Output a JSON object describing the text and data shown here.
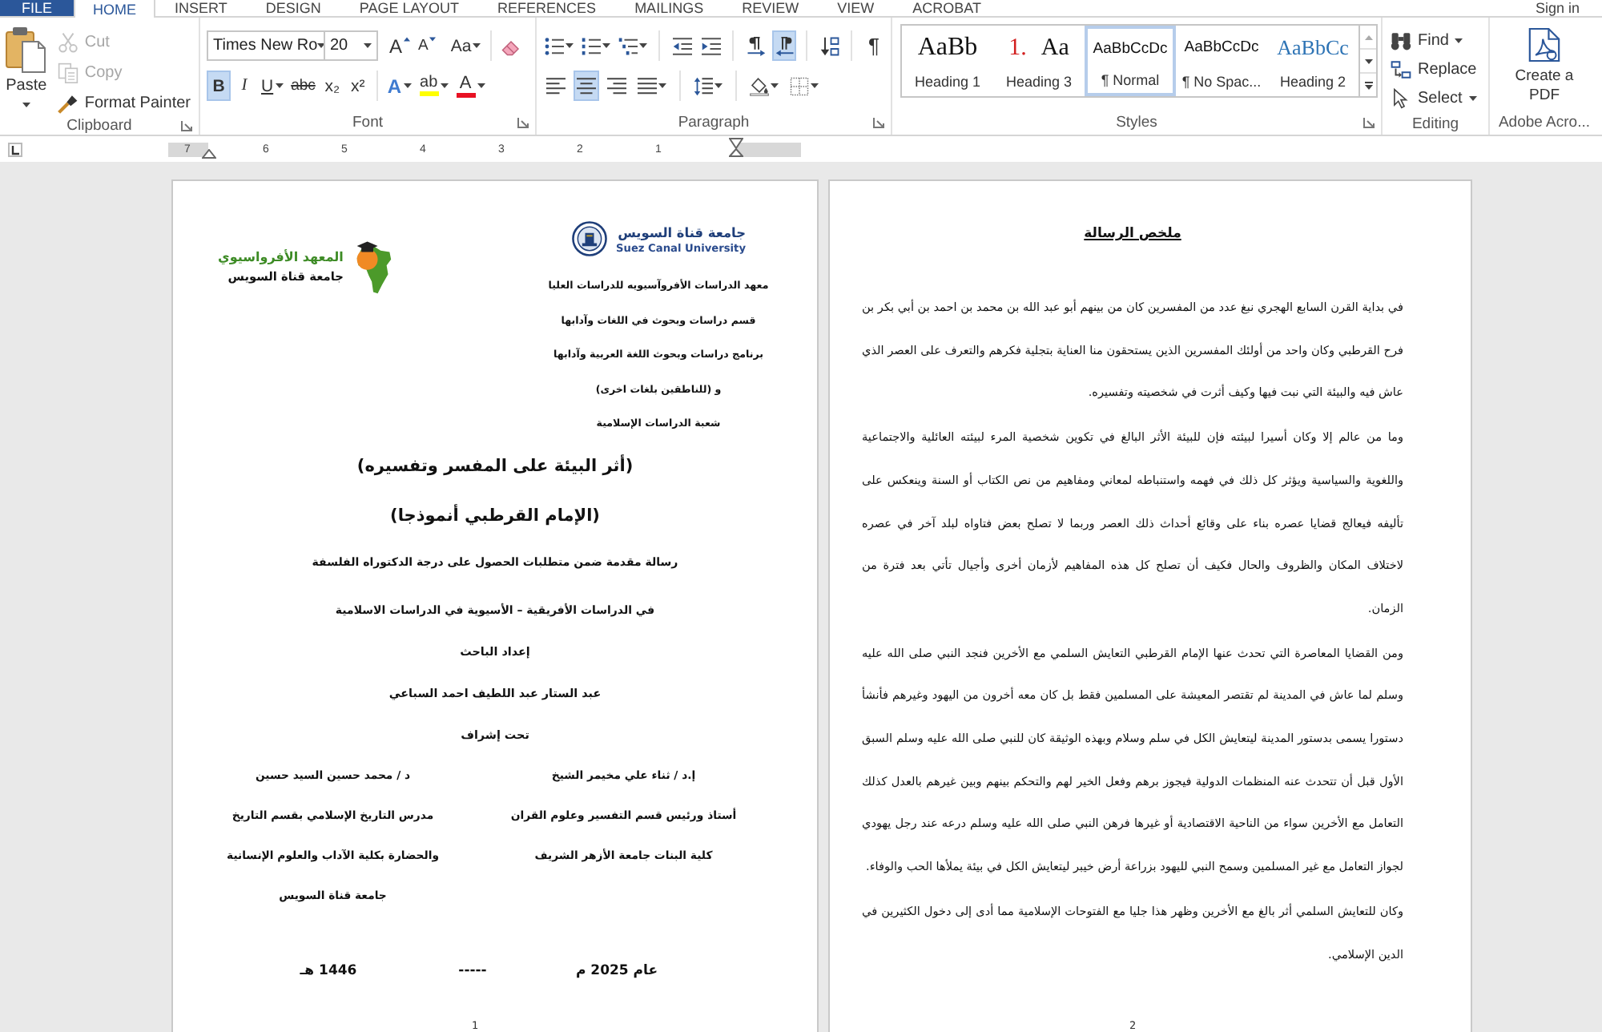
{
  "ribbon_tabs": {
    "tabs": [
      {
        "label": "ACROBAT",
        "kind": "tab",
        "selected": false
      },
      {
        "label": "VIEW",
        "kind": "tab",
        "selected": false
      },
      {
        "label": "REVIEW",
        "kind": "tab",
        "selected": false
      },
      {
        "label": "MAILINGS",
        "kind": "tab",
        "selected": false
      },
      {
        "label": "REFERENCES",
        "kind": "tab",
        "selected": false
      },
      {
        "label": "PAGE LAYOUT",
        "kind": "tab",
        "selected": false
      },
      {
        "label": "DESIGN",
        "kind": "tab",
        "selected": false
      },
      {
        "label": "INSERT",
        "kind": "tab",
        "selected": false
      },
      {
        "label": "HOME",
        "kind": "tab",
        "selected": true
      },
      {
        "label": "FILE",
        "kind": "file",
        "selected": false
      }
    ],
    "sign_in": "Sign in"
  },
  "clipboard": {
    "label": "Clipboard",
    "paste": "Paste",
    "items": [
      {
        "label": "Cut",
        "kind": "cut",
        "disabled": true
      },
      {
        "label": "Copy",
        "kind": "copy",
        "disabled": true
      },
      {
        "label": "Format Painter",
        "kind": "painter",
        "disabled": false
      }
    ]
  },
  "font": {
    "label": "Font",
    "top_row": [
      {
        "kind": "clear"
      },
      {
        "kind": "case",
        "glyph": "Aa",
        "menu": true,
        "divider": true
      },
      {
        "kind": "shrink",
        "glyph": "A"
      },
      {
        "kind": "grow",
        "glyph": "A"
      },
      {
        "kind": "font_size",
        "value": "20"
      },
      {
        "kind": "font_name",
        "value": "Times New Ro"
      }
    ],
    "bottom_row": [
      {
        "kind": "font_color",
        "glyph": "A",
        "menu": true,
        "color": "#e81123"
      },
      {
        "kind": "highlight",
        "glyph": "ab",
        "menu": true,
        "color": "#ffff00"
      },
      {
        "kind": "effects",
        "glyph": "A",
        "menu": true
      },
      {
        "kind": "superscript",
        "glyph": "x²",
        "selected": false,
        "divider": true
      },
      {
        "kind": "subscript",
        "glyph": "x₂",
        "selected": false
      },
      {
        "kind": "strike",
        "glyph": "abc",
        "selected": false
      },
      {
        "kind": "underline",
        "glyph": "U",
        "selected": false,
        "menu": true
      },
      {
        "kind": "italic",
        "glyph": "I",
        "selected": false
      },
      {
        "kind": "bold",
        "glyph": "B",
        "selected": true
      }
    ]
  },
  "paragraph": {
    "label": "Paragraph",
    "top_row": [
      {
        "kind": "pilcrow",
        "glyph": "¶",
        "selected": false
      },
      {
        "kind": "sort",
        "divider": true
      },
      {
        "kind": "rtl",
        "selected": true,
        "divider": true
      },
      {
        "kind": "ltr",
        "selected": false
      },
      {
        "kind": "increase_indent",
        "divider": true
      },
      {
        "kind": "decrease_indent"
      },
      {
        "kind": "multilevel",
        "menu": true,
        "divider": true
      },
      {
        "kind": "numbering",
        "menu": true
      },
      {
        "kind": "bullets",
        "menu": true
      }
    ],
    "bottom_row": [
      {
        "kind": "borders",
        "menu": true
      },
      {
        "kind": "shading",
        "menu": true
      },
      {
        "kind": "line_spacing",
        "menu": true,
        "divider": true
      },
      {
        "kind": "justify",
        "selected": false,
        "menu": true,
        "divider": true
      },
      {
        "kind": "align_right",
        "selected": false
      },
      {
        "kind": "align_center",
        "selected": true
      },
      {
        "kind": "align_left",
        "selected": false
      }
    ]
  },
  "styles": {
    "label": "Styles",
    "items": [
      {
        "preview": "AaBbCc",
        "name": "Heading 2",
        "kind": "heading_2",
        "selected": false
      },
      {
        "preview": "AaBbCcDc",
        "name": "¶ No Spac...",
        "kind": "body",
        "selected": false
      },
      {
        "preview": "AaBbCcDc",
        "name": "¶ Normal",
        "kind": "body",
        "selected": true
      },
      {
        "number": "1.",
        "preview": "Aa",
        "name": "Heading 3",
        "kind": "heading_3",
        "selected": false
      },
      {
        "preview": "AaBb",
        "name": "Heading 1",
        "kind": "heading_1",
        "selected": false
      }
    ]
  },
  "editing": {
    "label": "Editing",
    "items": [
      {
        "label": "Find",
        "kind": "find",
        "menu": true
      },
      {
        "label": "Replace",
        "kind": "replace"
      },
      {
        "label": "Select",
        "kind": "select",
        "menu": true
      }
    ]
  },
  "adobe": {
    "button": "Create a PDF",
    "label": "Adobe Acro..."
  },
  "ruler": {
    "numbers": [
      "1",
      "2",
      "3",
      "4",
      "5",
      "6",
      "7"
    ]
  },
  "pages": [
    {
      "kind": "abstract",
      "heading": "ملخص الرسالة",
      "paragraphs": [
        "في بداية القرن السابع الهجري نبغ عدد من المفسرين كان من بينهم أبو عبد الله بن محمد بن احمد بن أبي بكر بن فرح القرطبي وكان واحد من أولئك المفسرين الذين يستحقون منا العناية بتجلية فكرهم والتعرف على العصر الذي عاش فيه والبيئة التي نبت فيها وكيف أثرت في شخصيته وتفسيره.",
        "وما من عالم إلا وكان أسيرا لبيئته فإن للبيئة الأثر البالغ في تكوين شخصية المرء لبيئته العائلية والاجتماعية واللغوية والسياسية ويؤثر كل ذلك في فهمه واستنباطه لمعاني ومفاهيم من نص الكتاب أو السنة وينعكس على تأليفه فيعالج قضايا عصره بناء على وقائع أحداث ذلك العصر وربما لا تصلح بعض فتاواه لبلد آخر في عصره لاختلاف المكان والظروف والحال فكيف أن تصلح كل هذه المفاهيم لأزمان أخرى وأجيال تأتي بعد فترة من الزمان.",
        "ومن القضايا المعاصرة التي تحدث عنها الإمام القرطبي التعايش السلمي مع الأخرين فنجد النبي صلى الله عليه وسلم لما عاش في المدينة لم تقتصر المعيشة على المسلمين فقط بل كان معه أخرون من اليهود وغيرهم فأنشأ دستورا يسمى بدستور المدينة ليتعايش الكل في سلم وسلام وبهذه الوثيقة كان للنبي صلى الله عليه وسلم السبق الأول قبل أن تتحدث عنه المنظمات الدولية فيجوز برهم وفعل الخير لهم والتحكم بينهم وبين غيرهم بالعدل كذلك التعامل مع الأخرين سواء من الناحية الاقتصادية أو غيرها فرهن النبي صلى الله عليه وسلم درعه عند رجل يهودي لجواز التعامل مع غير المسلمين وسمح النبي لليهود بزراعة أرض خيبر ليتعايش الكل في بيئة يملأها الحب والوفاء.",
        "وكان للتعايش السلمي أثر بالغ مع الأخرين وظهر هذا جليا مع الفتوحات الإسلامية مما أدى إلى دخول الكثيرين في الدين الإسلامي."
      ],
      "page_number": "2"
    },
    {
      "kind": "cover",
      "university": {
        "name": "جامعة قناة السويس",
        "name_latin": "Suez Canal University"
      },
      "institute": {
        "name": "المعهد الأفرواسيوي",
        "university": "جامعة قناة السويس"
      },
      "header_lines": [
        "معهد الدراسات الأفروآسيويه للدراسات العليا",
        "قسم دراسات وبحوث في اللغات وآدابها",
        "برنامج دراسات وبحوث اللغة العربية وآدابها",
        "و (للناطقين بلغات اخرى)",
        "شعبة الدراسات الإسلامية"
      ],
      "title_lines": [
        "(أثر البيئة على المفسر وتفسيره)",
        "(الإمام القرطبي أنموذجا)"
      ],
      "description": "رسالة مقدمة ضمن متطلبات الحصول على درجة الدكتوراه الفلسفة",
      "program": "في الدراسات الأفريقية – الأسيوية في الدراسات الاسلامية",
      "prepared_by": "إعداد الباحث",
      "researcher": "عبد الستار عبد اللطيف احمد السباعي",
      "supervision": "تحت إشراف",
      "supervisors": [
        {
          "lines": [
            "إ.د / ثناء علي مخيمر الشيخ",
            "أستاذ ورئيس قسم التفسير وعلوم القران",
            "كلية البنات جامعة الأزهر الشريف"
          ]
        },
        {
          "lines": [
            "د / محمد حسين السيد حسين",
            "مدرس التاريخ الإسلامي بقسم التاريخ",
            "والحضارة بكلية الآداب والعلوم الإنسانية",
            "جامعة قناة السويس"
          ]
        }
      ],
      "date": {
        "gregorian": "عام 2025 م",
        "separator": "-----",
        "hijri": "1446 هـ"
      },
      "page_number": "1"
    }
  ]
}
